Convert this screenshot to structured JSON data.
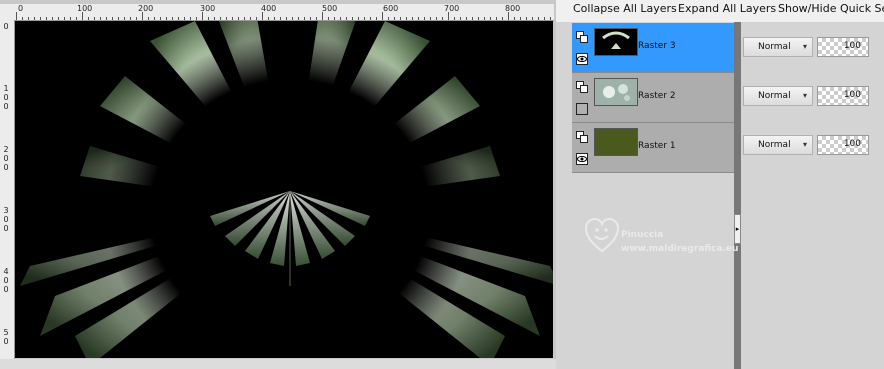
{
  "toolbar": {
    "collapse_label": "Collapse All Layers",
    "expand_label": "Expand All Layers",
    "quick_search_label": "Show/Hide Quick Sea"
  },
  "ruler": {
    "top_labels": [
      "0",
      "100",
      "200",
      "300",
      "400",
      "500",
      "600",
      "700",
      "800"
    ],
    "left_labels": [
      "0",
      "1 0 0",
      "2 0 0",
      "3 0 0",
      "4 0 0",
      "5 0"
    ]
  },
  "layers": [
    {
      "name": "Raster 3",
      "blend_mode": "Normal",
      "opacity": "100",
      "visible": true,
      "selected": true,
      "thumb_color": "#000000"
    },
    {
      "name": "Raster 2",
      "blend_mode": "Normal",
      "opacity": "100",
      "visible": false,
      "selected": false,
      "thumb_color": "#9fb2aa"
    },
    {
      "name": "Raster 1",
      "blend_mode": "Normal",
      "opacity": "100",
      "visible": true,
      "selected": false,
      "thumb_color": "#4a5a1f"
    }
  ],
  "watermark": {
    "name": "Pinuccia",
    "url": "www.maldiregrafica.eu"
  },
  "colors": {
    "selection": "#3399ff",
    "canvas_bg": "#000000",
    "ray_light": "#dce8d6",
    "ray_mid": "#6f8f64",
    "raster1_fill": "#4a5a1f"
  }
}
